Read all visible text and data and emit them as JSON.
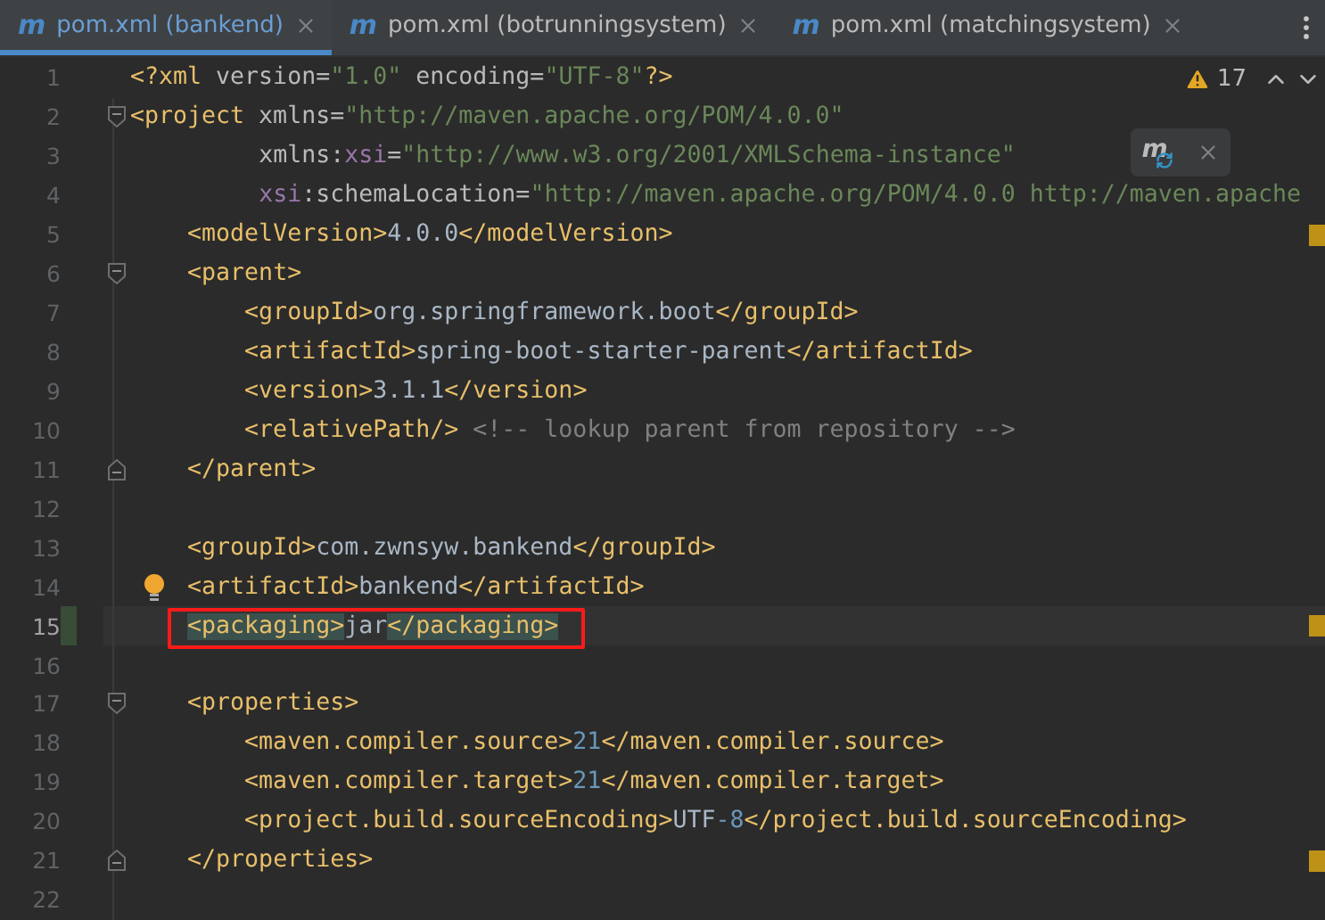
{
  "tabs": [
    {
      "icon": "m",
      "label": "pom.xml (bankend)",
      "selected": true
    },
    {
      "icon": "m",
      "label": "pom.xml (botrunningsystem)",
      "selected": false
    },
    {
      "icon": "m",
      "label": "pom.xml (matchingsystem)",
      "selected": false
    }
  ],
  "inspections": {
    "warnings": "17"
  },
  "popup": {
    "icon": "m"
  },
  "lines": [
    {
      "number": "1",
      "tokens": [
        {
          "kind": "tag",
          "text": "<?xml"
        },
        {
          "kind": "attr",
          "text": " version="
        },
        {
          "kind": "value",
          "text": "\"1.0\""
        },
        {
          "kind": "attr",
          "text": " encoding="
        },
        {
          "kind": "value",
          "text": "\"UTF-8\""
        },
        {
          "kind": "tag",
          "text": "?>"
        }
      ]
    },
    {
      "number": "2",
      "fold_start": true,
      "tokens": [
        {
          "kind": "tag",
          "text": "<project"
        },
        {
          "kind": "attr",
          "text": " xmlns="
        },
        {
          "kind": "value",
          "text": "\"http://maven.apache.org/POM/4.0.0\""
        }
      ]
    },
    {
      "number": "3",
      "tokens": [
        {
          "kind": "attr",
          "text": "         xmlns:"
        },
        {
          "kind": "ns",
          "text": "xsi"
        },
        {
          "kind": "attr",
          "text": "="
        },
        {
          "kind": "value",
          "text": "\"http://www.w3.org/2001/XMLSchema-instance\""
        }
      ]
    },
    {
      "number": "4",
      "tokens": [
        {
          "kind": "ns",
          "text": "         xsi"
        },
        {
          "kind": "attr",
          "text": ":schemaLocation="
        },
        {
          "kind": "value",
          "text": "\"http://maven.apache.org/POM/4.0.0 http://maven.apache"
        }
      ]
    },
    {
      "number": "5",
      "stripe": true,
      "tokens": [
        {
          "kind": "tag",
          "text": "    <modelVersion>"
        },
        {
          "kind": "text",
          "text": "4.0.0"
        },
        {
          "kind": "tag",
          "text": "</modelVersion>"
        }
      ]
    },
    {
      "number": "6",
      "fold_start": true,
      "tokens": [
        {
          "kind": "tag",
          "text": "    <parent>"
        }
      ]
    },
    {
      "number": "7",
      "tokens": [
        {
          "kind": "tag",
          "text": "        <groupId>"
        },
        {
          "kind": "text",
          "text": "org.springframework.boot"
        },
        {
          "kind": "tag",
          "text": "</groupId>"
        }
      ]
    },
    {
      "number": "8",
      "tokens": [
        {
          "kind": "tag",
          "text": "        <artifactId>"
        },
        {
          "kind": "text",
          "text": "spring-boot-starter-parent"
        },
        {
          "kind": "tag",
          "text": "</artifactId>"
        }
      ]
    },
    {
      "number": "9",
      "tokens": [
        {
          "kind": "tag",
          "text": "        <version>"
        },
        {
          "kind": "text",
          "text": "3.1.1"
        },
        {
          "kind": "tag",
          "text": "</version>"
        }
      ]
    },
    {
      "number": "10",
      "tokens": [
        {
          "kind": "tag",
          "text": "        <relativePath/>"
        },
        {
          "kind": "comment",
          "text": " <!-- lookup parent from repository -->"
        }
      ]
    },
    {
      "number": "11",
      "fold_end": true,
      "tokens": [
        {
          "kind": "tag",
          "text": "    </parent>"
        }
      ]
    },
    {
      "number": "12"
    },
    {
      "number": "13",
      "tokens": [
        {
          "kind": "tag",
          "text": "    <groupId>"
        },
        {
          "kind": "text",
          "text": "com.zwnsyw.bankend"
        },
        {
          "kind": "tag",
          "text": "</groupId>"
        }
      ]
    },
    {
      "number": "14",
      "bulb": true,
      "tokens": [
        {
          "kind": "tag",
          "text": "    <artifactId>"
        },
        {
          "kind": "text",
          "text": "bankend"
        },
        {
          "kind": "tag",
          "text": "</artifactId>"
        }
      ]
    },
    {
      "number": "15",
      "current": true,
      "changed": true,
      "boxed": true,
      "stripe": true,
      "tokens": [
        {
          "kind": "tag",
          "text": "    <packaging>",
          "matched": true
        },
        {
          "kind": "text",
          "text": "jar"
        },
        {
          "kind": "tag",
          "text": "</packaging>",
          "matched": true
        }
      ]
    },
    {
      "number": "16"
    },
    {
      "number": "17",
      "fold_start": true,
      "tokens": [
        {
          "kind": "tag",
          "text": "    <properties>"
        }
      ]
    },
    {
      "number": "18",
      "tokens": [
        {
          "kind": "tag",
          "text": "        <maven.compiler.source>"
        },
        {
          "kind": "number",
          "text": "21"
        },
        {
          "kind": "tag",
          "text": "</maven.compiler.source>"
        }
      ]
    },
    {
      "number": "19",
      "tokens": [
        {
          "kind": "tag",
          "text": "        <maven.compiler.target>"
        },
        {
          "kind": "number",
          "text": "21"
        },
        {
          "kind": "tag",
          "text": "</maven.compiler.target>"
        }
      ]
    },
    {
      "number": "20",
      "tokens": [
        {
          "kind": "tag",
          "text": "        <project.build.sourceEncoding>"
        },
        {
          "kind": "text",
          "text": "UTF"
        },
        {
          "kind": "number",
          "text": "-8"
        },
        {
          "kind": "tag",
          "text": "</project.build.sourceEncoding>"
        }
      ]
    },
    {
      "number": "21",
      "fold_end": true,
      "stripe": true,
      "tokens": [
        {
          "kind": "tag",
          "text": "    </properties>"
        }
      ]
    },
    {
      "number": "22"
    }
  ]
}
